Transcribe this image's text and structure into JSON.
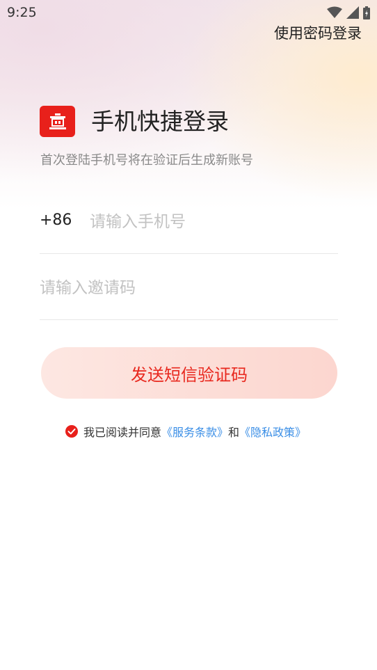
{
  "status_bar": {
    "time": "9:25"
  },
  "header": {
    "password_login_label": "使用密码登录"
  },
  "login": {
    "title": "手机快捷登录",
    "subtitle": "首次登陆手机号将在验证后生成新账号",
    "country_code": "+86",
    "phone_placeholder": "请输入手机号",
    "invite_placeholder": "请输入邀请码",
    "send_code_label": "发送短信验证码"
  },
  "agreement": {
    "prefix": "我已阅读并同意",
    "terms_link": "《服务条款》",
    "conjunction": "和",
    "privacy_link": "《隐私政策》",
    "checked": true
  },
  "colors": {
    "accent": "#e8201b",
    "link": "#3a8ee6",
    "button_bg": "#fcd6cf"
  },
  "icons": {
    "logo": "building-logo-icon",
    "agreement_check": "check-circle-icon",
    "status": [
      "wifi-icon",
      "signal-icon",
      "battery-icon"
    ]
  }
}
